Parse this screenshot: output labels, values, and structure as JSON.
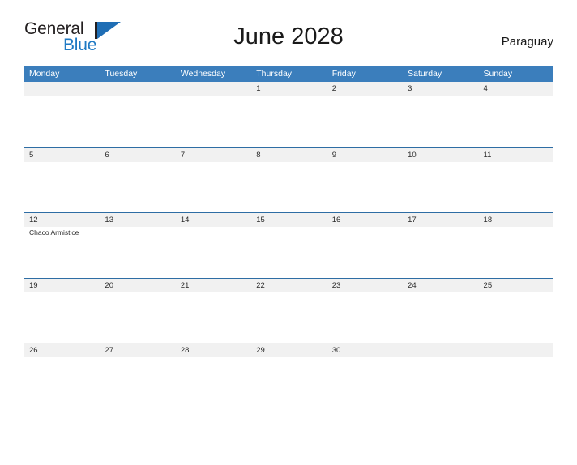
{
  "brand": {
    "name_dark": "General",
    "name_blue": "Blue",
    "mark": "flag-triangle-icon",
    "accent_blue": "#1f7ac4",
    "dark": "#231f20"
  },
  "header": {
    "title": "June 2028",
    "country": "Paraguay"
  },
  "colors": {
    "header_bar": "#3b7ebc",
    "row_border": "#2e6da4",
    "date_band": "#f1f1f1",
    "page_background": "#ffffff",
    "text": "#2b2b2b"
  },
  "calendar": {
    "weekday_headers": [
      "Monday",
      "Tuesday",
      "Wednesday",
      "Thursday",
      "Friday",
      "Saturday",
      "Sunday"
    ],
    "weeks": [
      [
        {
          "num": "",
          "event": ""
        },
        {
          "num": "",
          "event": ""
        },
        {
          "num": "",
          "event": ""
        },
        {
          "num": "1",
          "event": ""
        },
        {
          "num": "2",
          "event": ""
        },
        {
          "num": "3",
          "event": ""
        },
        {
          "num": "4",
          "event": ""
        }
      ],
      [
        {
          "num": "5",
          "event": ""
        },
        {
          "num": "6",
          "event": ""
        },
        {
          "num": "7",
          "event": ""
        },
        {
          "num": "8",
          "event": ""
        },
        {
          "num": "9",
          "event": ""
        },
        {
          "num": "10",
          "event": ""
        },
        {
          "num": "11",
          "event": ""
        }
      ],
      [
        {
          "num": "12",
          "event": "Chaco Armistice"
        },
        {
          "num": "13",
          "event": ""
        },
        {
          "num": "14",
          "event": ""
        },
        {
          "num": "15",
          "event": ""
        },
        {
          "num": "16",
          "event": ""
        },
        {
          "num": "17",
          "event": ""
        },
        {
          "num": "18",
          "event": ""
        }
      ],
      [
        {
          "num": "19",
          "event": ""
        },
        {
          "num": "20",
          "event": ""
        },
        {
          "num": "21",
          "event": ""
        },
        {
          "num": "22",
          "event": ""
        },
        {
          "num": "23",
          "event": ""
        },
        {
          "num": "24",
          "event": ""
        },
        {
          "num": "25",
          "event": ""
        }
      ],
      [
        {
          "num": "26",
          "event": ""
        },
        {
          "num": "27",
          "event": ""
        },
        {
          "num": "28",
          "event": ""
        },
        {
          "num": "29",
          "event": ""
        },
        {
          "num": "30",
          "event": ""
        },
        {
          "num": "",
          "event": ""
        },
        {
          "num": "",
          "event": ""
        }
      ]
    ]
  }
}
